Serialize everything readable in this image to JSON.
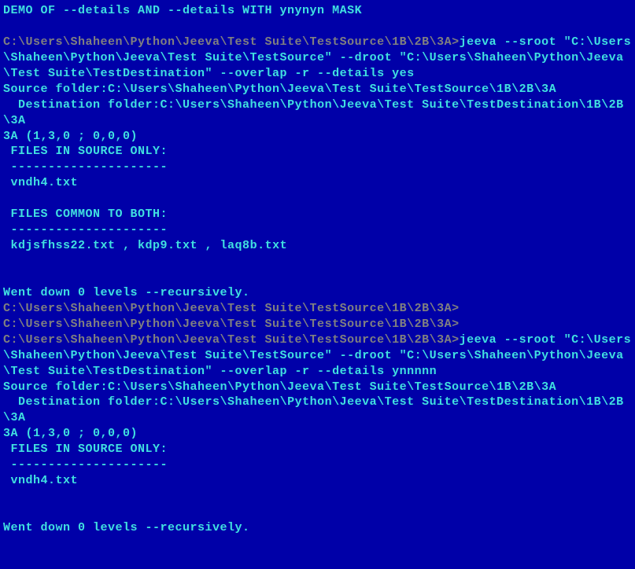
{
  "terminal": {
    "title": "DEMO OF --details AND --details WITH ynynyn MASK",
    "blank1": "",
    "prompt1": "C:\\Users\\Shaheen\\Python\\Jeeva\\Test Suite\\TestSource\\1B\\2B\\3A>",
    "cmd1": "jeeva --sroot \"C:\\Users\\Shaheen\\Python\\Jeeva\\Test Suite\\TestSource\" --droot \"C:\\Users\\Shaheen\\Python\\Jeeva\\Test Suite\\TestDestination\" --overlap -r --details yes",
    "src_folder1": "Source folder:C:\\Users\\Shaheen\\Python\\Jeeva\\Test Suite\\TestSource\\1B\\2B\\3A",
    "dst_folder1": "  Destination folder:C:\\Users\\Shaheen\\Python\\Jeeva\\Test Suite\\TestDestination\\1B\\2B\\3A",
    "stats1": "3A (1,3,0 ; 0,0,0)",
    "src_only_header1": " FILES IN SOURCE ONLY:",
    "divider1": " ---------------------",
    "src_only_files1": " vndh4.txt",
    "blank2": "",
    "common_header1": " FILES COMMON TO BOTH:",
    "divider2": " ---------------------",
    "common_files1": " kdjsfhss22.txt , kdp9.txt , laq8b.txt",
    "blank3": "",
    "blank4": "",
    "went_down1": "Went down 0 levels --recursively.",
    "prompt2": "C:\\Users\\Shaheen\\Python\\Jeeva\\Test Suite\\TestSource\\1B\\2B\\3A>",
    "prompt3": "C:\\Users\\Shaheen\\Python\\Jeeva\\Test Suite\\TestSource\\1B\\2B\\3A>",
    "prompt4": "C:\\Users\\Shaheen\\Python\\Jeeva\\Test Suite\\TestSource\\1B\\2B\\3A>",
    "cmd2": "jeeva --sroot \"C:\\Users\\Shaheen\\Python\\Jeeva\\Test Suite\\TestSource\" --droot \"C:\\Users\\Shaheen\\Python\\Jeeva\\Test Suite\\TestDestination\" --overlap -r --details ynnnnn",
    "src_folder2": "Source folder:C:\\Users\\Shaheen\\Python\\Jeeva\\Test Suite\\TestSource\\1B\\2B\\3A",
    "dst_folder2": "  Destination folder:C:\\Users\\Shaheen\\Python\\Jeeva\\Test Suite\\TestDestination\\1B\\2B\\3A",
    "stats2": "3A (1,3,0 ; 0,0,0)",
    "src_only_header2": " FILES IN SOURCE ONLY:",
    "divider3": " ---------------------",
    "src_only_files2": " vndh4.txt",
    "blank5": "",
    "blank6": "",
    "went_down2": "Went down 0 levels --recursively."
  }
}
